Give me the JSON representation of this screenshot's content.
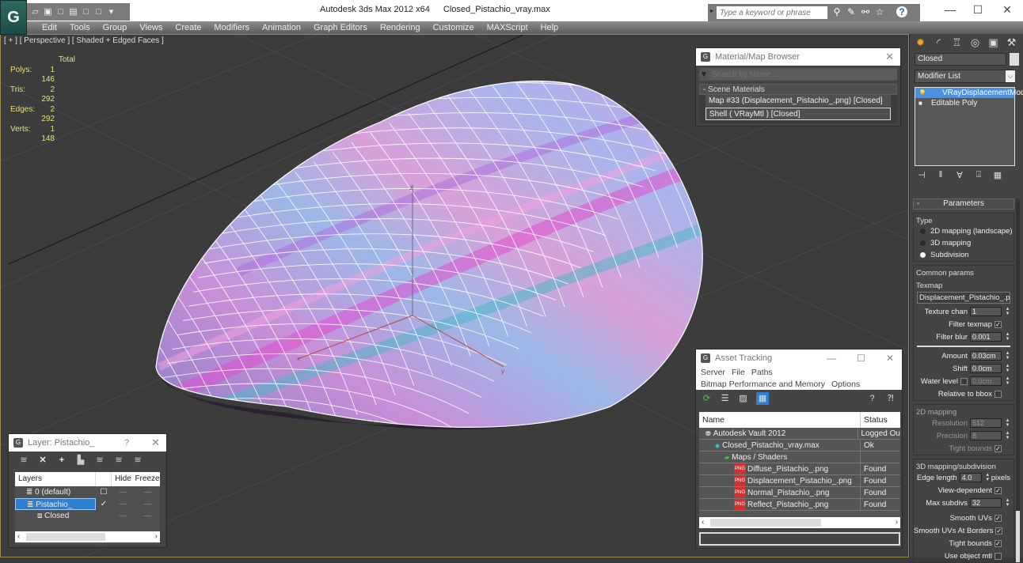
{
  "app": {
    "logo_glyph": "G",
    "title_app": "Autodesk 3ds Max  2012 x64",
    "title_file": "Closed_Pistachio_vray.max",
    "search_placeholder": "Type a keyword or phrase",
    "window_controls": {
      "minimize": "—",
      "maximize": "☐",
      "close": "✕"
    }
  },
  "quick_access": [
    "open-icon",
    "save-icon",
    "new-icon",
    "hold-icon",
    "window-icon",
    "window2-icon",
    "dropdown-icon"
  ],
  "menus": [
    "Edit",
    "Tools",
    "Group",
    "Views",
    "Create",
    "Modifiers",
    "Animation",
    "Graph Editors",
    "Rendering",
    "Customize",
    "MAXScript",
    "Help"
  ],
  "viewport": {
    "label": "[ + ] [ Perspective ] [ Shaded + Edged Faces ]",
    "stats": {
      "header": "Total",
      "rows": [
        {
          "label": "Polys:",
          "value": "1 146"
        },
        {
          "label": "Tris:",
          "value": "2 292"
        },
        {
          "label": "Edges:",
          "value": "2 292"
        },
        {
          "label": "Verts:",
          "value": "1 148"
        }
      ]
    },
    "axes": {
      "x": "x",
      "y": "y",
      "z": "z"
    }
  },
  "material_browser": {
    "title": "Material/Map Browser",
    "search_placeholder": "Search by Name ...",
    "group": "- Scene Materials",
    "items": [
      {
        "label": "Map #33 (Displacement_Pistachio_.png) [Closed]",
        "selected": false
      },
      {
        "label": "Shell  ( VRayMtl )  [Closed]",
        "selected": true
      }
    ]
  },
  "command_panel": {
    "object_name": "Closed",
    "modifier_list": "Modifier List",
    "stack": [
      {
        "label": "VRayDisplacementMod",
        "selected": true,
        "icon": "bulb-icon"
      },
      {
        "label": "Editable Poly",
        "selected": false,
        "icon": "square-icon"
      }
    ],
    "parameters": {
      "title": "Parameters",
      "type_group": "Type",
      "type_options": [
        {
          "label": "2D mapping (landscape)",
          "selected": false
        },
        {
          "label": "3D mapping",
          "selected": false
        },
        {
          "label": "Subdivision",
          "selected": true
        }
      ],
      "common_group": "Common params",
      "texmap_label": "Texmap",
      "texmap_value": "Displacement_Pistachio_.png)",
      "texture_chan": {
        "label": "Texture chan",
        "value": "1"
      },
      "filter_texmap": {
        "label": "Filter texmap",
        "checked": true
      },
      "filter_blur": {
        "label": "Filter blur",
        "value": "0.001"
      },
      "amount": {
        "label": "Amount",
        "value": "0.03cm"
      },
      "shift": {
        "label": "Shift",
        "value": "0.0cm"
      },
      "water_level": {
        "label": "Water level",
        "checked": false,
        "value": "0.0cm"
      },
      "relative_bbox": {
        "label": "Relative to bbox",
        "checked": false
      },
      "mapping2d_group": "2D mapping",
      "resolution": {
        "label": "Resolution",
        "value": "512"
      },
      "precision": {
        "label": "Precision",
        "value": "8"
      },
      "tight_bounds_2d": {
        "label": "Tight bounds",
        "checked": true
      },
      "mapping3d_group": "3D mapping/subdivision",
      "edge_length": {
        "label": "Edge length",
        "value": "4.0",
        "unit": "pixels"
      },
      "view_dependent": {
        "label": "View-dependent",
        "checked": true
      },
      "max_subdivs": {
        "label": "Max subdivs",
        "value": "32"
      },
      "smooth_uvs": {
        "label": "Smooth UVs",
        "checked": true
      },
      "smooth_uvs_borders": {
        "label": "Smooth UVs At Borders",
        "checked": true
      },
      "tight_bounds_3d": {
        "label": "Tight bounds",
        "checked": true
      },
      "use_object_mtl": {
        "label": "Use object mtl",
        "checked": false
      }
    }
  },
  "asset_tracking": {
    "title": "Asset Tracking",
    "menus": [
      "Server",
      "File",
      "Paths",
      "Bitmap Performance and Memory",
      "Options"
    ],
    "columns": [
      "Name",
      "Status"
    ],
    "rows": [
      {
        "name": "Autodesk Vault 2012",
        "status": "Logged Ou",
        "indent": 1,
        "icon": "vault-icon"
      },
      {
        "name": "Closed_Pistachio_vray.max",
        "status": "Ok",
        "indent": 2,
        "icon": "max-file-icon"
      },
      {
        "name": "Maps / Shaders",
        "status": "",
        "indent": 3,
        "icon": "maps-icon"
      },
      {
        "name": "Diffuse_Pistachio_.png",
        "status": "Found",
        "indent": 4,
        "icon": "png-icon"
      },
      {
        "name": "Displacement_Pistachio_.png",
        "status": "Found",
        "indent": 4,
        "icon": "png-icon"
      },
      {
        "name": "Normal_Pistachio_.png",
        "status": "Found",
        "indent": 4,
        "icon": "png-icon"
      },
      {
        "name": "Reflect_Pistachio_.png",
        "status": "Found",
        "indent": 4,
        "icon": "png-icon"
      }
    ]
  },
  "layer_dialog": {
    "title": "Layer: Pistachio_",
    "help": "?",
    "columns": [
      "Layers",
      "",
      "Hide",
      "Freeze"
    ],
    "rows": [
      {
        "name": "0 (default)",
        "check": "☐",
        "selected": false,
        "indent": 1
      },
      {
        "name": "Pistachio_",
        "check": "✓",
        "selected": true,
        "indent": 1
      },
      {
        "name": "Closed",
        "check": "",
        "selected": false,
        "indent": 2
      }
    ]
  },
  "colors": {
    "accent_blue": "#2f7fd0",
    "viewport_border": "#9a8d48",
    "stats_text": "#e5e07a"
  }
}
